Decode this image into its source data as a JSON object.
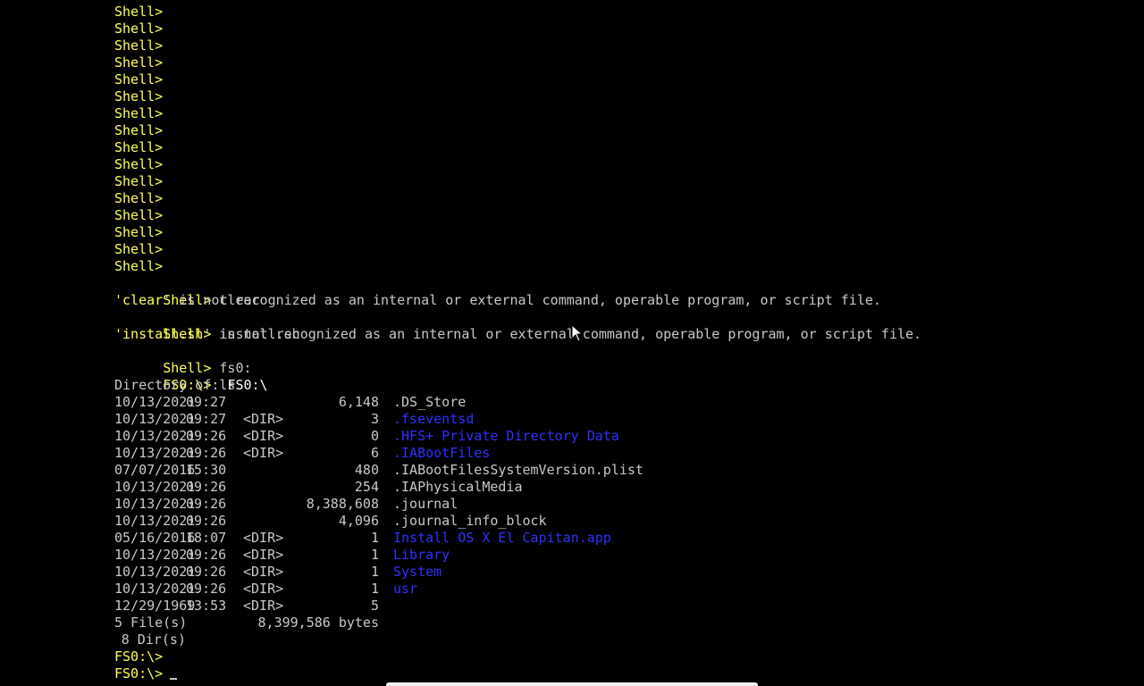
{
  "terminal": {
    "shell_prompt": "Shell>",
    "fs_prompt": "FS0:\\>",
    "history": [
      {
        "prompt": "Shell>",
        "command": ""
      },
      {
        "prompt": "Shell>",
        "command": ""
      },
      {
        "prompt": "Shell>",
        "command": ""
      },
      {
        "prompt": "Shell>",
        "command": ""
      },
      {
        "prompt": "Shell>",
        "command": ""
      },
      {
        "prompt": "Shell>",
        "command": ""
      },
      {
        "prompt": "Shell>",
        "command": ""
      },
      {
        "prompt": "Shell>",
        "command": ""
      },
      {
        "prompt": "Shell>",
        "command": ""
      },
      {
        "prompt": "Shell>",
        "command": ""
      },
      {
        "prompt": "Shell>",
        "command": ""
      },
      {
        "prompt": "Shell>",
        "command": ""
      },
      {
        "prompt": "Shell>",
        "command": ""
      },
      {
        "prompt": "Shell>",
        "command": ""
      },
      {
        "prompt": "Shell>",
        "command": ""
      },
      {
        "prompt": "Shell>",
        "command": ""
      }
    ],
    "cmd_clear": {
      "prompt": "Shell>",
      "command": "clear"
    },
    "err_clear": {
      "open": "'",
      "name": "clear",
      "rest": "' is not recognized as an internal or external command, operable program, or script file."
    },
    "cmd_install": {
      "prompt": "Shell>",
      "command": "install.sh"
    },
    "err_install": {
      "open": "'",
      "name": "install.sh",
      "rest": "' is not recognized as an internal or external command, operable program, or script file."
    },
    "cmd_fs0": {
      "prompt": "Shell>",
      "command": "fs0:"
    },
    "cmd_ls": {
      "prompt": "FS0:\\>",
      "command": "ls"
    },
    "directory_label": "Directory of: ",
    "directory_path": "FS0:\\",
    "entries": [
      {
        "date": "10/13/2021",
        "time": "09:27",
        "tag": "",
        "size": "6,148",
        "name": ".DS_Store",
        "is_dir": false
      },
      {
        "date": "10/13/2021",
        "time": "09:27",
        "tag": "<DIR>",
        "size": "3",
        "name": ".fseventsd",
        "is_dir": true
      },
      {
        "date": "10/13/2021",
        "time": "09:26",
        "tag": "<DIR>",
        "size": "0",
        "name": ".HFS+ Private Directory Data",
        "is_dir": true
      },
      {
        "date": "10/13/2021",
        "time": "09:26",
        "tag": "<DIR>",
        "size": "6",
        "name": ".IABootFiles",
        "is_dir": true
      },
      {
        "date": "07/07/2016",
        "time": "15:30",
        "tag": "",
        "size": "480",
        "name": ".IABootFilesSystemVersion.plist",
        "is_dir": false
      },
      {
        "date": "10/13/2021",
        "time": "09:26",
        "tag": "",
        "size": "254",
        "name": ".IAPhysicalMedia",
        "is_dir": false
      },
      {
        "date": "10/13/2021",
        "time": "09:26",
        "tag": "",
        "size": "8,388,608",
        "name": ".journal",
        "is_dir": false
      },
      {
        "date": "10/13/2021",
        "time": "09:26",
        "tag": "",
        "size": "4,096",
        "name": ".journal_info_block",
        "is_dir": false
      },
      {
        "date": "05/16/2016",
        "time": "18:07",
        "tag": "<DIR>",
        "size": "1",
        "name": "Install OS X El Capitan.app",
        "is_dir": true
      },
      {
        "date": "10/13/2021",
        "time": "09:26",
        "tag": "<DIR>",
        "size": "1",
        "name": "Library",
        "is_dir": true
      },
      {
        "date": "10/13/2021",
        "time": "09:26",
        "tag": "<DIR>",
        "size": "1",
        "name": "System",
        "is_dir": true
      },
      {
        "date": "10/13/2021",
        "time": "09:26",
        "tag": "<DIR>",
        "size": "1",
        "name": "usr",
        "is_dir": true
      },
      {
        "date": "12/29/1969",
        "time": "13:53",
        "tag": "<DIR>",
        "size": "5",
        "name": "",
        "is_dir": true
      }
    ],
    "summary_files": "5 File(s)",
    "summary_bytes": "8,399,586 bytes",
    "summary_dirs": "8 Dir(s)",
    "final_prompts": [
      "FS0:\\>",
      "FS0:\\>"
    ]
  },
  "colors": {
    "background": "#000000",
    "prompt": "#ffff55",
    "text": "#c8c8c8",
    "directory": "#3030ff"
  },
  "icons": {
    "pointer": "mouse-pointer-icon",
    "cursor": "text-cursor"
  }
}
